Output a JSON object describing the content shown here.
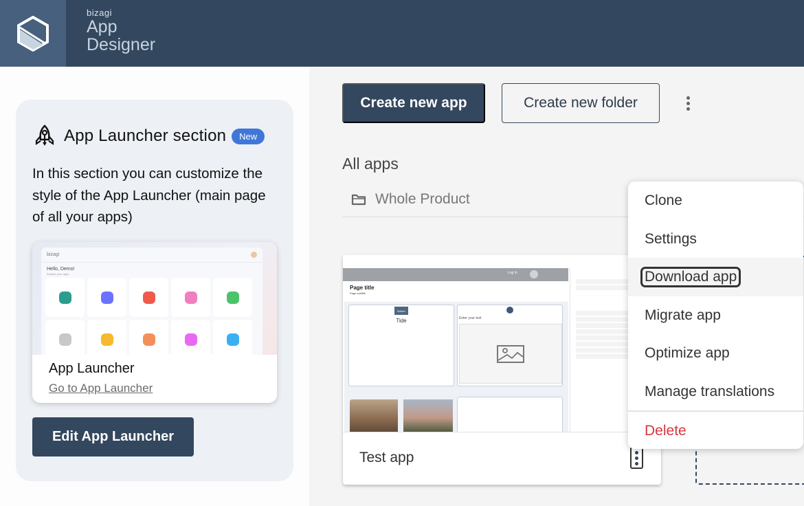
{
  "header": {
    "brand_small": "bizagi",
    "brand_line1": "App",
    "brand_line2": "Designer",
    "logo_icon": "hexagon-logo-icon"
  },
  "launcher_section": {
    "icon": "rocket-icon",
    "title": "App Launcher section",
    "badge": "New",
    "description": "In this section you can customize the style of the App Launcher (main page of all your apps)",
    "preview": {
      "greeting": "Hello, Demo!",
      "subgreeting": "Explore your apps",
      "brand": "bizagi",
      "tile_colors": [
        "#2a9d8f",
        "#6c72ff",
        "#ef5a4c",
        "#f07fbf",
        "#4cc36a",
        "#c8c8c8",
        "#f7b92e",
        "#f48f5c",
        "#e86af0",
        "#3ab0f2"
      ],
      "name": "App Launcher",
      "link": "Go to App Launcher"
    },
    "edit_button": "Edit App Launcher"
  },
  "toolbar": {
    "create_app": "Create new app",
    "create_folder": "Create new folder",
    "more_icon": "vertical-dots-icon"
  },
  "apps": {
    "section_title": "All apps",
    "folders": [
      {
        "icon": "folder-icon",
        "name": "Whole Product"
      }
    ],
    "cards": [
      {
        "name": "Test app",
        "thumbnail": {
          "login": "Log In",
          "page_title": "Page title",
          "page_subtitle": "Page subtitle",
          "button": "Button",
          "tide": "Tide",
          "enter_text": "Enter your text"
        }
      }
    ]
  },
  "context_menu": {
    "items": [
      {
        "label": "Clone",
        "state": "normal"
      },
      {
        "label": "Settings",
        "state": "normal"
      },
      {
        "label": "Download app",
        "state": "focused"
      },
      {
        "label": "Migrate app",
        "state": "normal"
      },
      {
        "label": "Optimize app",
        "state": "normal"
      },
      {
        "label": "Manage translations",
        "state": "normal"
      },
      {
        "label": "Delete",
        "state": "danger"
      }
    ]
  },
  "colors": {
    "primary": "#33475e",
    "badge": "#3f76d8",
    "danger": "#d9363e"
  }
}
